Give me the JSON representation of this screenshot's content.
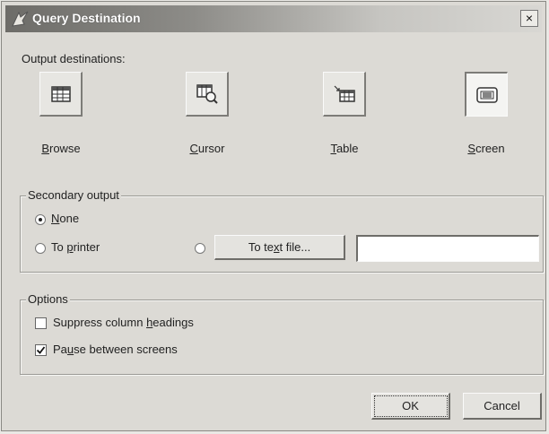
{
  "window": {
    "title": "Query Destination",
    "close_glyph": "×"
  },
  "output_destinations": {
    "label": "Output destinations:",
    "items": [
      {
        "label_pre": "",
        "label_u": "B",
        "label_post": "rowse",
        "icon": "browse-icon",
        "selected": false
      },
      {
        "label_pre": "",
        "label_u": "C",
        "label_post": "ursor",
        "icon": "cursor-icon",
        "selected": false
      },
      {
        "label_pre": "",
        "label_u": "T",
        "label_post": "able",
        "icon": "table-icon",
        "selected": false
      },
      {
        "label_pre": "",
        "label_u": "S",
        "label_post": "creen",
        "icon": "screen-icon",
        "selected": true
      }
    ]
  },
  "secondary_output": {
    "title": "Secondary output",
    "none": {
      "pre": "",
      "u": "N",
      "post": "one",
      "selected": true
    },
    "printer": {
      "pre": "To ",
      "u": "p",
      "post": "rinter",
      "selected": false
    },
    "text_file": {
      "pre": "To te",
      "u": "x",
      "post": "t file...",
      "selected": false
    },
    "text_file_value": ""
  },
  "options": {
    "title": "Options",
    "suppress": {
      "pre": "Suppress column ",
      "u": "h",
      "post": "eadings",
      "checked": false
    },
    "pause": {
      "pre": "Pa",
      "u": "u",
      "post": "se between screens",
      "checked": true
    }
  },
  "buttons": {
    "ok": "OK",
    "cancel": "Cancel"
  },
  "colors": {
    "face": "#dcdad5",
    "shadow": "#7d7c78",
    "highlight": "#fafafa"
  }
}
